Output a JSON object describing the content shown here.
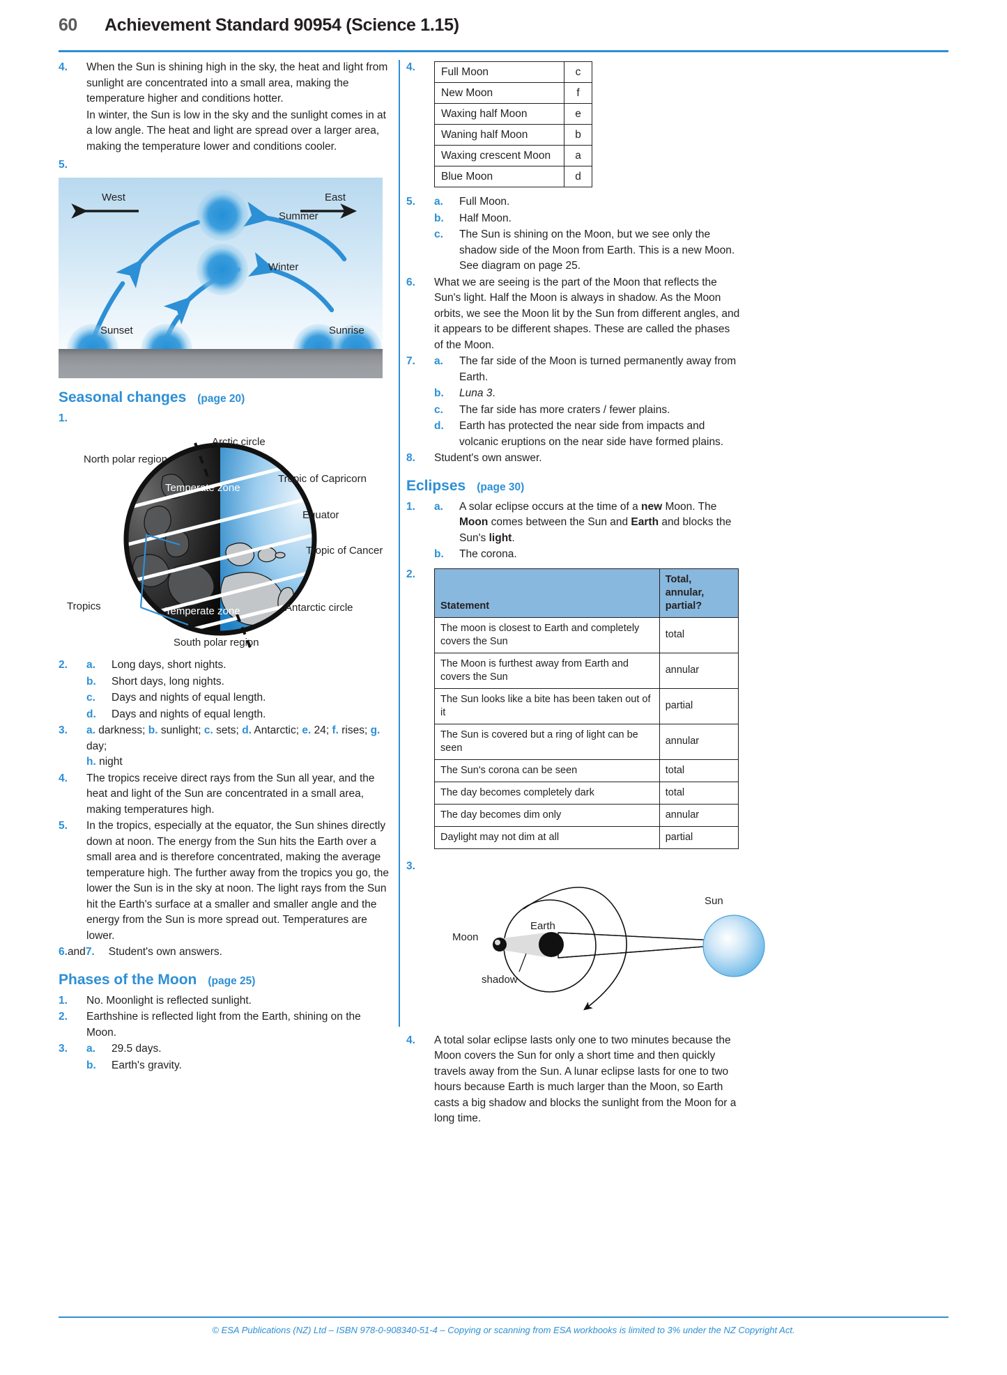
{
  "header": {
    "page_number": "60",
    "title": "Achievement Standard 90954 (Science 1.15)"
  },
  "left_column": {
    "q4": {
      "num": "4.",
      "para1": "When the Sun is shining high in the sky, the heat and light from sunlight are concentrated into a small area, making the temperature higher and conditions hotter.",
      "para2": "In winter, the Sun is low in the sky and the sunlight comes in at a low angle. The heat and light are spread over a larger area, making the temperature lower and conditions cooler."
    },
    "q5": {
      "num": "5."
    },
    "sun_diagram": {
      "west": "West",
      "east": "East",
      "summer": "Summer",
      "winter": "Winter",
      "sunset": "Sunset",
      "sunrise": "Sunrise"
    },
    "seasonal_section": {
      "title": "Seasonal changes",
      "page_ref": "(page 20)"
    },
    "q1": {
      "num": "1."
    },
    "earth_diagram": {
      "arctic_circle": "Arctic circle",
      "north_polar_region": "North polar region",
      "tropic_of_capricorn": "Tropic of Capricorn",
      "equator": "Equator",
      "tropic_of_cancer": "Tropic of Cancer",
      "temperate_zone_north": "Temperate zone",
      "temperate_zone_south": "Temperate zone",
      "tropics": "Tropics",
      "antarctic_circle": "Antarctic circle",
      "south_polar_region": "South polar region"
    },
    "q2": {
      "num": "2.",
      "items": [
        {
          "letter": "a.",
          "text": "Long days, short nights."
        },
        {
          "letter": "b.",
          "text": "Short days, long nights."
        },
        {
          "letter": "c.",
          "text": "Days and nights of equal length."
        },
        {
          "letter": "d.",
          "text": "Days and nights of equal length."
        }
      ]
    },
    "q3": {
      "num": "3.",
      "line1_parts": [
        {
          "letter": "a.",
          "text": " darkness; "
        },
        {
          "letter": "b.",
          "text": " sunlight; "
        },
        {
          "letter": "c.",
          "text": " sets; "
        },
        {
          "letter": "d.",
          "text": " Antarctic; "
        },
        {
          "letter": "e.",
          "text": " 24; "
        },
        {
          "letter": "f.",
          "text": " rises; "
        },
        {
          "letter": "g.",
          "text": " day;"
        }
      ],
      "line2_letter": "h.",
      "line2_text": " night"
    },
    "q4b": {
      "num": "4.",
      "text": "The tropics receive direct rays from the Sun all year, and the heat and light of the Sun are concentrated in a small area, making temperatures high."
    },
    "q5b": {
      "num": "5.",
      "text": "In the tropics, especially at the equator, the Sun shines directly down at noon. The energy from the Sun hits the Earth over a small area and is therefore concentrated, making the average temperature high. The further away from the tropics you go, the lower the Sun is in the sky at noon. The light rays from the Sun hit the Earth's surface at a smaller and smaller angle and the energy from the Sun is more spread out. Temperatures are lower."
    },
    "q67": {
      "num_a": "6.",
      "and": " and ",
      "num_b": "7.",
      "text": "Student's own answers."
    },
    "phases_section": {
      "title": "Phases of the Moon",
      "page_ref": "(page 25)"
    },
    "p1": {
      "num": "1.",
      "text": "No. Moonlight is reflected sunlight."
    },
    "p2": {
      "num": "2.",
      "text": "Earthshine is reflected light from the Earth, shining on the Moon."
    },
    "p3": {
      "num": "3.",
      "items": [
        {
          "letter": "a.",
          "text": "29.5 days."
        },
        {
          "letter": "b.",
          "text": "Earth's gravity."
        }
      ]
    }
  },
  "right_column": {
    "q4": {
      "num": "4.",
      "table_rows": [
        {
          "name": "Full Moon",
          "code": "c"
        },
        {
          "name": "New Moon",
          "code": "f"
        },
        {
          "name": "Waxing half Moon",
          "code": "e"
        },
        {
          "name": "Waning half Moon",
          "code": "b"
        },
        {
          "name": "Waxing crescent Moon",
          "code": "a"
        },
        {
          "name": "Blue Moon",
          "code": "d"
        }
      ]
    },
    "q5": {
      "num": "5.",
      "items": [
        {
          "letter": "a.",
          "text": "Full Moon."
        },
        {
          "letter": "b.",
          "text": "Half Moon."
        },
        {
          "letter": "c.",
          "text": "The Sun is shining on the Moon, but we see only the shadow side of the Moon from Earth. This is a new Moon. See diagram on page 25."
        }
      ]
    },
    "q6": {
      "num": "6.",
      "text": "What we are seeing is the part of the Moon that reflects the Sun's light. Half the Moon is always in shadow. As the Moon orbits, we see the Moon lit by the Sun from different angles, and it appears to be different shapes. These are called the phases of the Moon."
    },
    "q7": {
      "num": "7.",
      "items": [
        {
          "letter": "a.",
          "text": "The far side of the Moon is turned permanently away from Earth.",
          "italic": ""
        },
        {
          "letter": "b.",
          "text": "",
          "italic": "Luna 3",
          "after": "."
        },
        {
          "letter": "c.",
          "text": "The far side has more craters / fewer plains.",
          "italic": ""
        },
        {
          "letter": "d.",
          "text": "Earth has protected the near side from impacts and volcanic eruptions on the near side have formed plains.",
          "italic": ""
        }
      ]
    },
    "q8": {
      "num": "8.",
      "text": "Student's own answer."
    },
    "eclipses_section": {
      "title": "Eclipses",
      "page_ref": "(page 30)"
    },
    "e1": {
      "num": "1.",
      "a": {
        "letter": "a.",
        "seg1": "A solar eclipse occurs at the time of a ",
        "bold1": "new",
        "seg2": " Moon. The ",
        "bold2": "Moon",
        "seg3": " comes between the Sun and ",
        "bold3": "Earth",
        "seg4": " and blocks the Sun's ",
        "bold4": "light",
        "seg5": "."
      },
      "b": {
        "letter": "b.",
        "text": "The corona."
      }
    },
    "e2": {
      "num": "2.",
      "headers": {
        "c1": "Statement",
        "c2": "Total, annular, partial?"
      },
      "rows": [
        {
          "statement": "The moon is closest to Earth and completely covers the Sun",
          "answer": "total"
        },
        {
          "statement": "The Moon is furthest away from Earth and covers the Sun",
          "answer": "annular"
        },
        {
          "statement": "The Sun looks like a bite has been taken out of it",
          "answer": "partial"
        },
        {
          "statement": "The Sun is covered but a ring of light can be seen",
          "answer": "annular"
        },
        {
          "statement": "The Sun's corona can be seen",
          "answer": "total"
        },
        {
          "statement": "The day becomes completely dark",
          "answer": "total"
        },
        {
          "statement": "The day becomes dim only",
          "answer": "annular"
        },
        {
          "statement": "Daylight may not dim at all",
          "answer": "partial"
        }
      ]
    },
    "e3": {
      "num": "3.",
      "diagram": {
        "moon": "Moon",
        "earth": "Earth",
        "sun": "Sun",
        "shadow": "shadow"
      }
    },
    "e4": {
      "num": "4.",
      "text": "A total solar eclipse lasts only one to two minutes because the Moon covers the Sun for only a short time and then quickly travels away from the Sun. A lunar eclipse lasts for one to two hours because Earth is much larger than the Moon, so Earth casts a big shadow and blocks the sunlight from the Moon for a long time."
    }
  },
  "footer": {
    "text": "© ESA Publications (NZ) Ltd – ISBN 978-0-908340-51-4 – Copying or scanning from ESA workbooks is limited to 3% under the NZ Copyright Act."
  },
  "colors": {
    "accent_blue": "#2d8fd5",
    "table_header_blue": "#88b8de",
    "text": "#231f20"
  }
}
